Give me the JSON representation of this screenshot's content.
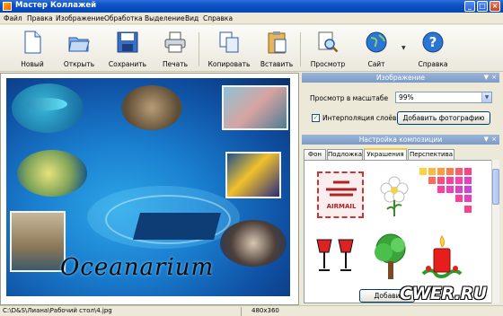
{
  "window": {
    "title": "Мастер Коллажей"
  },
  "menu": [
    "Файл",
    "Правка",
    "Изображение",
    "Обработка",
    "Выделение",
    "Вид",
    "Справка"
  ],
  "toolbar": {
    "new": "Новый",
    "open": "Открыть",
    "save": "Сохранить",
    "print": "Печать",
    "copy": "Копировать",
    "paste": "Вставить",
    "preview": "Просмотр",
    "site": "Сайт",
    "help": "Справка"
  },
  "canvas": {
    "caption": "Oceanarium"
  },
  "panel": {
    "image_section": "Изображение",
    "zoom_label": "Просмотр в масштабе",
    "zoom_value": "99%",
    "interpolation_label": "Интерполяция слоёв",
    "interpolation_checked": true,
    "add_photo": "Добавить фотографию",
    "composition_section": "Настройка композиции",
    "tabs": [
      "Фон",
      "Подложка",
      "Украшения",
      "Перспектива"
    ],
    "active_tab": "Украшения",
    "clip_labels": {
      "airmail": "AIRMAIL"
    },
    "add_button": "Добави"
  },
  "status": {
    "path": "C:\\D&S\\Лиана\\Рабочий стол\\4.jpg",
    "dims": "480x360"
  },
  "watermark": "CWER.RU"
}
